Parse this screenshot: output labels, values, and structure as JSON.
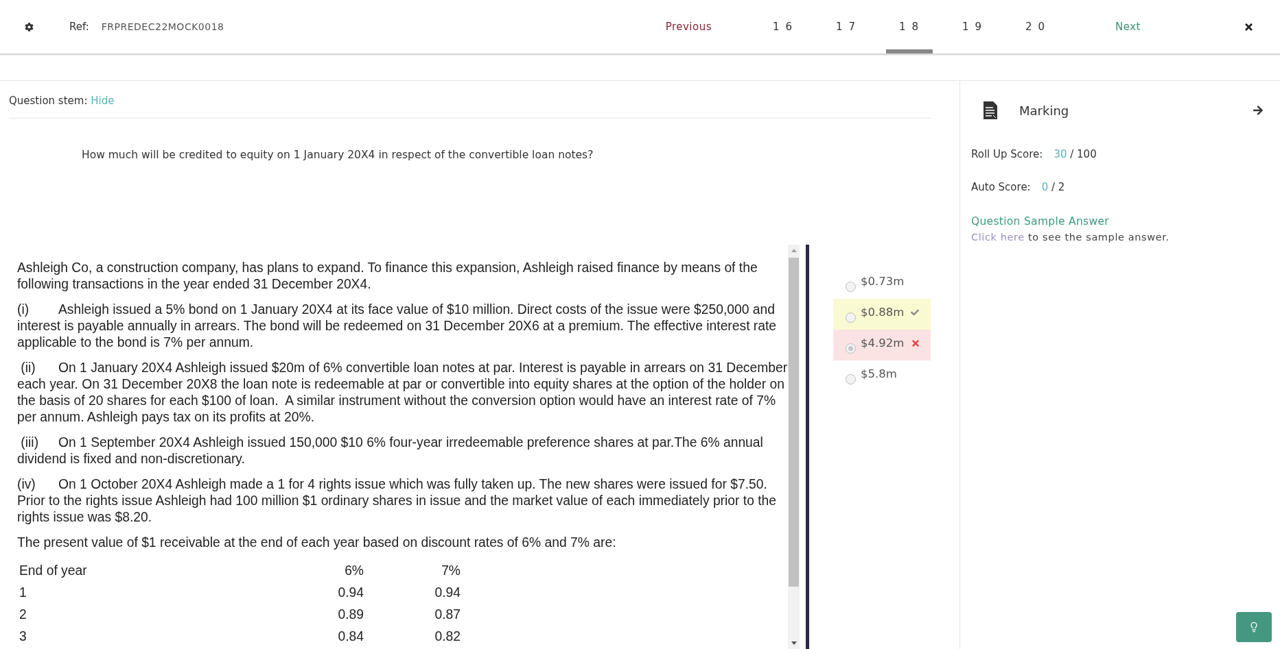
{
  "header": {
    "ref_label": "Ref:",
    "ref_value": "FRPREDEC22MOCK0018",
    "previous": "Previous",
    "next": "Next",
    "pages": [
      {
        "label": "1 6",
        "selected": false
      },
      {
        "label": "1 7",
        "selected": false
      },
      {
        "label": "1 8",
        "selected": true
      },
      {
        "label": "1 9",
        "selected": false
      },
      {
        "label": "2 0",
        "selected": false
      }
    ]
  },
  "question": {
    "stem_label": "Question stem:",
    "stem_toggle": "Hide",
    "text": "How much will be credited to equity on 1 January 20X4 in respect of the convertible loan notes?"
  },
  "passage": {
    "paragraphs": [
      "Ashleigh Co, a construction company, has plans to expand. To finance this expansion, Ashleigh raised finance by means of the following transactions in the year ended 31 December 20X4.",
      "(i)\tAshleigh issued a 5% bond on 1 January 20X4 at its face value of $10 million. Direct costs of the issue were $250,000 and interest is payable annually in arrears. The bond will be redeemed on 31 December 20X6 at a premium. The effective interest rate applicable to the bond is 7% per annum.",
      " (ii)\tOn 1 January 20X4 Ashleigh issued $20m of 6% convertible loan notes at par. Interest is payable in arrears on 31 December each year. On 31 December 20X8 the loan note is redeemable at par or convertible into equity shares at the option of the holder on the basis of 20 shares for each $100 of loan.  A similar instrument without the conversion option would have an interest rate of 7% per annum. Ashleigh pays tax on its profits at 20%.",
      " (iii)\tOn 1 September 20X4 Ashleigh issued 150,000 $10 6% four-year irredeemable preference shares at par.The 6% annual dividend is fixed and non-discretionary.",
      "(iv)\tOn 1 October 20X4 Ashleigh made a 1 for 4 rights issue which was fully taken up. The new shares were issued for $7.50. Prior to the rights issue Ashleigh had 100 million $1 ordinary shares in issue and the market value of each immediately prior to the rights issue was $8.20.",
      "The present value of $1 receivable at the end of each year based on discount rates of 6% and 7% are:"
    ],
    "table": {
      "columns": [
        "End of year",
        "6%",
        "7%"
      ],
      "rows": [
        [
          "1",
          "0.94",
          "0.94"
        ],
        [
          "2",
          "0.89",
          "0.87"
        ],
        [
          "3",
          "0.84",
          "0.82"
        ]
      ]
    }
  },
  "options": [
    {
      "text": "$0.73m",
      "selected": false,
      "marked_correct": false,
      "marked_wrong": false
    },
    {
      "text": "$0.88m",
      "selected": false,
      "marked_correct": true,
      "marked_wrong": false
    },
    {
      "text": "$4.92m",
      "selected": true,
      "marked_correct": false,
      "marked_wrong": true
    },
    {
      "text": "$5.8m",
      "selected": false,
      "marked_correct": false,
      "marked_wrong": false
    }
  ],
  "marking": {
    "title": "Marking",
    "scores": [
      {
        "label": "Roll Up Score:",
        "value": "30",
        "total": "/ 100"
      },
      {
        "label": "Auto Score:",
        "value": "0",
        "total": "/ 2"
      }
    ],
    "sample_title": "Question Sample Answer",
    "sample_link": "Click here",
    "sample_text": " to see the sample answer."
  }
}
